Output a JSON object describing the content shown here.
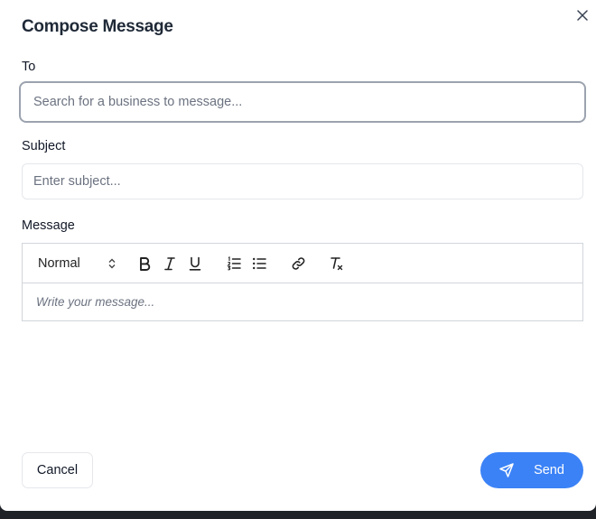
{
  "dialog": {
    "title": "Compose Message",
    "close_icon": "close-icon"
  },
  "to": {
    "label": "To",
    "placeholder": "Search for a business to message...",
    "value": ""
  },
  "subject": {
    "label": "Subject",
    "placeholder": "Enter subject...",
    "value": ""
  },
  "message": {
    "label": "Message",
    "placeholder": "Write your message...",
    "toolbar": {
      "heading_value": "Normal",
      "icons": [
        "bold-icon",
        "italic-icon",
        "underline-icon",
        "ordered-list-icon",
        "bullet-list-icon",
        "link-icon",
        "clear-format-icon"
      ]
    }
  },
  "actions": {
    "cancel_label": "Cancel",
    "send_label": "Send",
    "send_icon": "paper-plane-icon"
  },
  "colors": {
    "accent": "#3b82f6",
    "text": "#111827",
    "border": "#e5e7eb"
  }
}
